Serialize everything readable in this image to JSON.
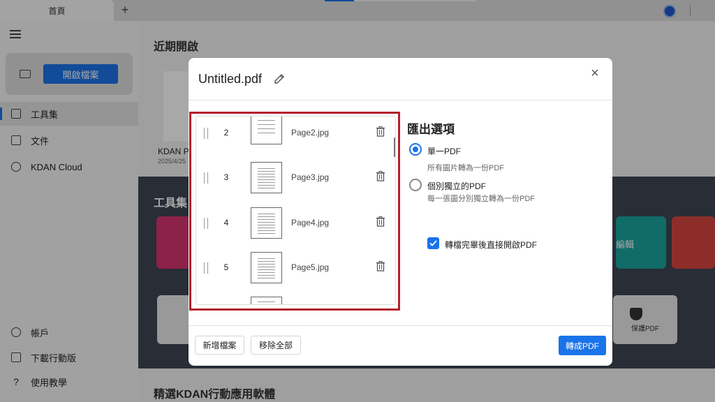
{
  "tabbar": {
    "home_tab": "首頁",
    "add_tab": "+"
  },
  "sidebar": {
    "open_button": "開啟檔案",
    "items": [
      {
        "label": "工具集",
        "icon": "toolbox-icon"
      },
      {
        "label": "文件",
        "icon": "document-icon"
      },
      {
        "label": "KDAN Cloud",
        "icon": "cloud-icon"
      },
      {
        "label": "帳戶",
        "icon": "user-icon"
      },
      {
        "label": "下載行動版",
        "icon": "mobile-icon"
      },
      {
        "label": "使用教學",
        "icon": "help-icon"
      }
    ]
  },
  "main": {
    "recent_title": "近期開啟",
    "recent_file": {
      "name": "KDAN P",
      "date": "2025/4/25"
    },
    "tools_title": "工具集",
    "tool_card_fragments": [
      "",
      "編輯",
      ""
    ],
    "protect_label": "保護PDF",
    "featured_title": "精選KDAN行動應用軟體"
  },
  "dialog": {
    "title": "Untitled.pdf",
    "files": [
      {
        "num": "2",
        "name": "Page2.jpg"
      },
      {
        "num": "3",
        "name": "Page3.jpg"
      },
      {
        "num": "4",
        "name": "Page4.jpg"
      },
      {
        "num": "5",
        "name": "Page5.jpg"
      }
    ],
    "options_title": "匯出選項",
    "option_single": {
      "label": "單一PDF",
      "desc": "所有圖片轉為一份PDF",
      "selected": true
    },
    "option_separate": {
      "label": "個別獨立的PDF",
      "desc": "每一張圖分別獨立轉為一份PDF",
      "selected": false
    },
    "open_after": {
      "label": "轉檔完畢後直接開啟PDF",
      "checked": true
    },
    "add_files_button": "新增檔案",
    "remove_all_button": "移除全部",
    "convert_button": "轉成PDF"
  },
  "colors": {
    "accent": "#1a73e8",
    "highlight_frame": "#b3202c",
    "tools_band": "#3e4553"
  }
}
